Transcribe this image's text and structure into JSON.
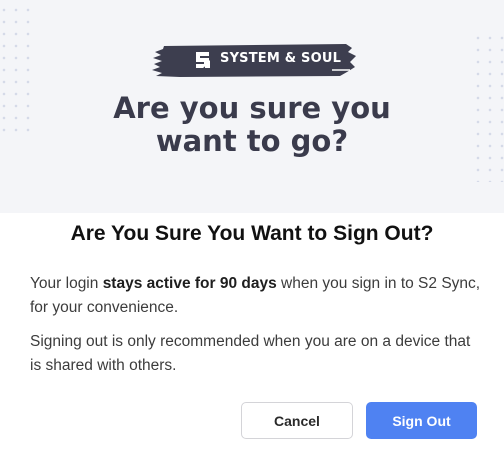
{
  "brand": {
    "logo_icon": "s2-logo-icon",
    "name": "SYSTEM & SOUL"
  },
  "hero": {
    "heading_line1": "Are you sure you",
    "heading_line2": "want to go?"
  },
  "dialog": {
    "title": "Are You Sure You Want to Sign Out?",
    "paragraph1_prefix": "Your login ",
    "paragraph1_bold": "stays active for 90 days",
    "paragraph1_suffix": " when you sign in to S2 Sync, for your convenience.",
    "paragraph2": "Signing out is only recommended when you are on a device that is shared with others."
  },
  "buttons": {
    "cancel_label": "Cancel",
    "signout_label": "Sign Out"
  },
  "colors": {
    "hero_bg": "#f4f5f8",
    "hero_heading": "#3a3b4c",
    "brush_stroke": "#3d3e4f",
    "primary": "#4f82f2"
  }
}
